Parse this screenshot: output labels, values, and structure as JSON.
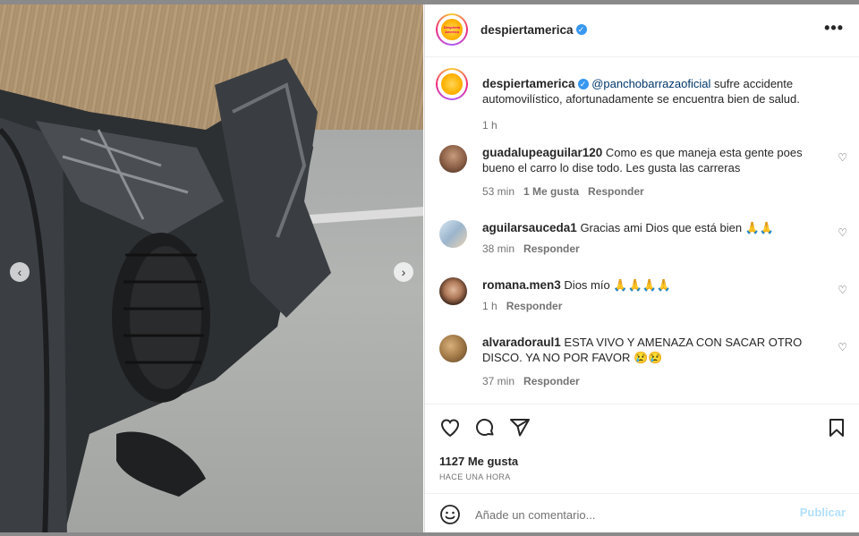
{
  "post": {
    "username": "despiertamerica",
    "verified_icon": "verified-badge-icon",
    "avatar_text": "Despierta America",
    "caption": {
      "mention": "@panchobarrazaoficial",
      "text": " sufre accidente automovilístico, afortunadamente se encuentra bien de salud.",
      "time": "1 h"
    },
    "media_alt": "Crashed car photo"
  },
  "comments": [
    {
      "user": "guadalupeaguilar120",
      "text": "Como es que maneja esta gente poes bueno el carro lo dise todo. Les gusta las carreras",
      "time": "53 min",
      "likes": "1 Me gusta",
      "reply": "Responder"
    },
    {
      "user": "aguilarsauceda1",
      "text": "Gracias ami Dios que está bien 🙏🙏",
      "time": "38 min",
      "likes": "",
      "reply": "Responder"
    },
    {
      "user": "romana.men3",
      "text": "Dios mío 🙏🙏🙏🙏",
      "time": "1 h",
      "likes": "",
      "reply": "Responder"
    },
    {
      "user": "alvaradoraul1",
      "text": "ESTA VIVO Y AMENAZA CON SACAR OTRO DISCO. YA NO POR FAVOR 😢😢",
      "time": "37 min",
      "likes": "",
      "reply": "Responder"
    }
  ],
  "actions": {
    "likes_count": "1127 Me gusta",
    "time_ago": "HACE UNA HORA",
    "icons": [
      "heart-icon",
      "comment-icon",
      "share-icon",
      "bookmark-icon"
    ]
  },
  "composer": {
    "placeholder": "Añade un comentario...",
    "publish_label": "Publicar",
    "emoji_icon": "smiley-icon"
  },
  "colors": {
    "link": "#00376b",
    "verified": "#3897f0",
    "publish_disabled": "#b2dffc",
    "muted": "#737373"
  }
}
